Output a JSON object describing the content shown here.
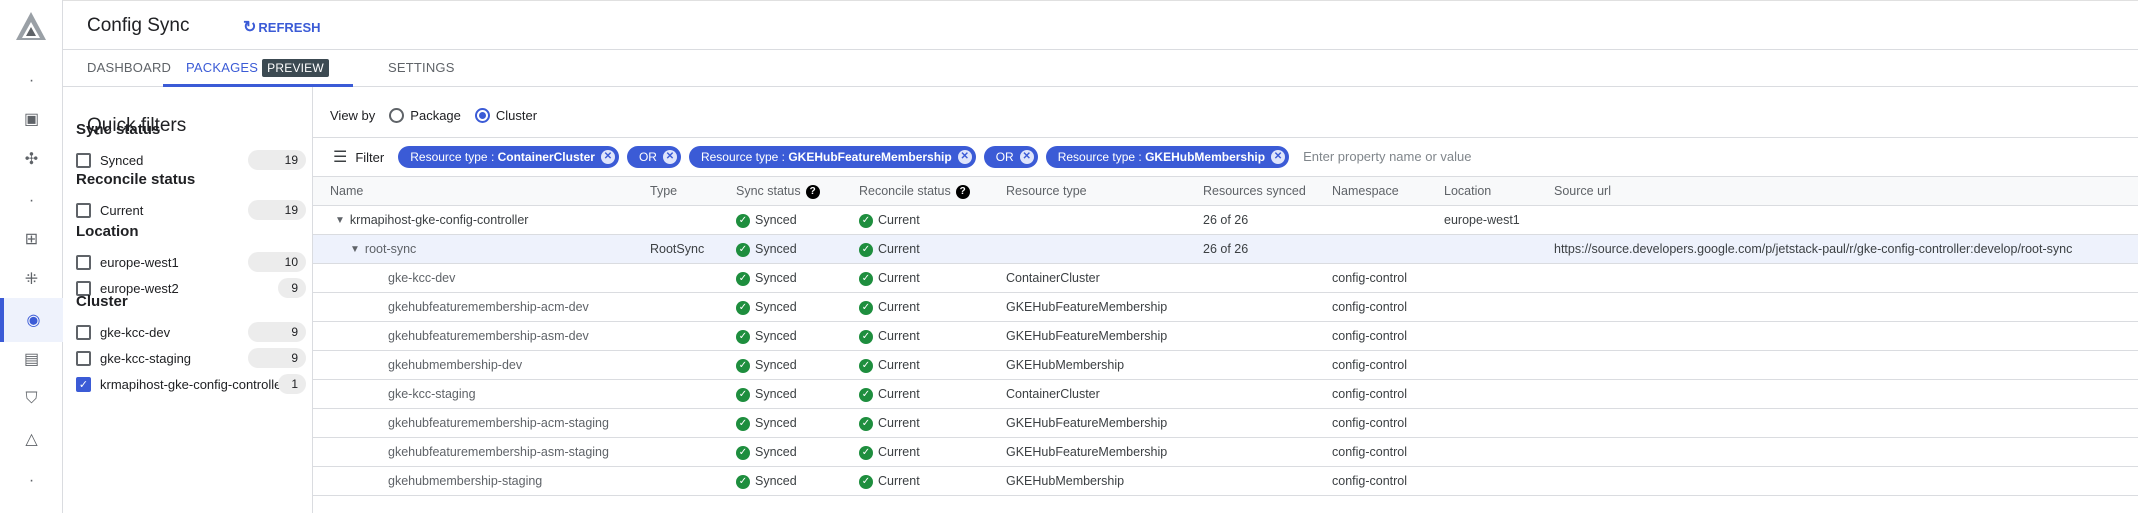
{
  "header": {
    "title": "Config Sync",
    "refresh_label": "REFRESH"
  },
  "tabs": [
    {
      "label": "DASHBOARD"
    },
    {
      "label": "PACKAGES",
      "badge": "PREVIEW"
    },
    {
      "label": "SETTINGS"
    }
  ],
  "quick_filters": {
    "title": "Quick filters",
    "sections": [
      {
        "title": "Sync status",
        "options": [
          {
            "label": "Synced",
            "count": "19",
            "checked": false
          }
        ]
      },
      {
        "title": "Reconcile status",
        "options": [
          {
            "label": "Current",
            "count": "19",
            "checked": false
          }
        ]
      },
      {
        "title": "Location",
        "options": [
          {
            "label": "europe-west1",
            "count": "10",
            "checked": false
          },
          {
            "label": "europe-west2",
            "count": "9",
            "checked": false
          }
        ]
      },
      {
        "title": "Cluster",
        "options": [
          {
            "label": "gke-kcc-dev",
            "count": "9",
            "checked": false
          },
          {
            "label": "gke-kcc-staging",
            "count": "9",
            "checked": false
          },
          {
            "label": "krmapihost-gke-config-controller",
            "count": "1",
            "checked": true
          }
        ]
      }
    ]
  },
  "view_by": {
    "label": "View by",
    "options": [
      "Package",
      "Cluster"
    ],
    "selected": "Cluster"
  },
  "filter": {
    "label": "Filter",
    "placeholder": "Enter property name or value",
    "chips": [
      {
        "key": "Resource type : ",
        "value": "ContainerCluster"
      },
      {
        "key": "",
        "value": "OR"
      },
      {
        "key": "Resource type : ",
        "value": "GKEHubFeatureMembership"
      },
      {
        "key": "",
        "value": "OR"
      },
      {
        "key": "Resource type : ",
        "value": "GKEHubMembership"
      }
    ]
  },
  "table": {
    "columns": [
      "Name",
      "Type",
      "Sync status",
      "Reconcile status",
      "Resource type",
      "Resources synced",
      "Namespace",
      "Location",
      "Source url"
    ],
    "rows": [
      {
        "level": 0,
        "name": "krmapihost-gke-config-controller",
        "type": "",
        "sync": "Synced",
        "reconcile": "Current",
        "resource_type": "",
        "synced": "26 of 26",
        "namespace": "",
        "location": "europe-west1",
        "source": ""
      },
      {
        "level": 1,
        "name": "root-sync",
        "type": "RootSync",
        "sync": "Synced",
        "reconcile": "Current",
        "resource_type": "",
        "synced": "26 of 26",
        "namespace": "",
        "location": "",
        "source": "https://source.developers.google.com/p/jetstack-paul/r/gke-config-controller:develop/root-sync"
      },
      {
        "level": 2,
        "name": "gke-kcc-dev",
        "type": "",
        "sync": "Synced",
        "reconcile": "Current",
        "resource_type": "ContainerCluster",
        "synced": "",
        "namespace": "config-control",
        "location": "",
        "source": ""
      },
      {
        "level": 2,
        "name": "gkehubfeaturemembership-acm-dev",
        "type": "",
        "sync": "Synced",
        "reconcile": "Current",
        "resource_type": "GKEHubFeatureMembership",
        "synced": "",
        "namespace": "config-control",
        "location": "",
        "source": ""
      },
      {
        "level": 2,
        "name": "gkehubfeaturemembership-asm-dev",
        "type": "",
        "sync": "Synced",
        "reconcile": "Current",
        "resource_type": "GKEHubFeatureMembership",
        "synced": "",
        "namespace": "config-control",
        "location": "",
        "source": ""
      },
      {
        "level": 2,
        "name": "gkehubmembership-dev",
        "type": "",
        "sync": "Synced",
        "reconcile": "Current",
        "resource_type": "GKEHubMembership",
        "synced": "",
        "namespace": "config-control",
        "location": "",
        "source": ""
      },
      {
        "level": 2,
        "name": "gke-kcc-staging",
        "type": "",
        "sync": "Synced",
        "reconcile": "Current",
        "resource_type": "ContainerCluster",
        "synced": "",
        "namespace": "config-control",
        "location": "",
        "source": ""
      },
      {
        "level": 2,
        "name": "gkehubfeaturemembership-acm-staging",
        "type": "",
        "sync": "Synced",
        "reconcile": "Current",
        "resource_type": "GKEHubFeatureMembership",
        "synced": "",
        "namespace": "config-control",
        "location": "",
        "source": ""
      },
      {
        "level": 2,
        "name": "gkehubfeaturemembership-asm-staging",
        "type": "",
        "sync": "Synced",
        "reconcile": "Current",
        "resource_type": "GKEHubFeatureMembership",
        "synced": "",
        "namespace": "config-control",
        "location": "",
        "source": ""
      },
      {
        "level": 2,
        "name": "gkehubmembership-staging",
        "type": "",
        "sync": "Synced",
        "reconcile": "Current",
        "resource_type": "GKEHubMembership",
        "synced": "",
        "namespace": "config-control",
        "location": "",
        "source": ""
      }
    ]
  }
}
